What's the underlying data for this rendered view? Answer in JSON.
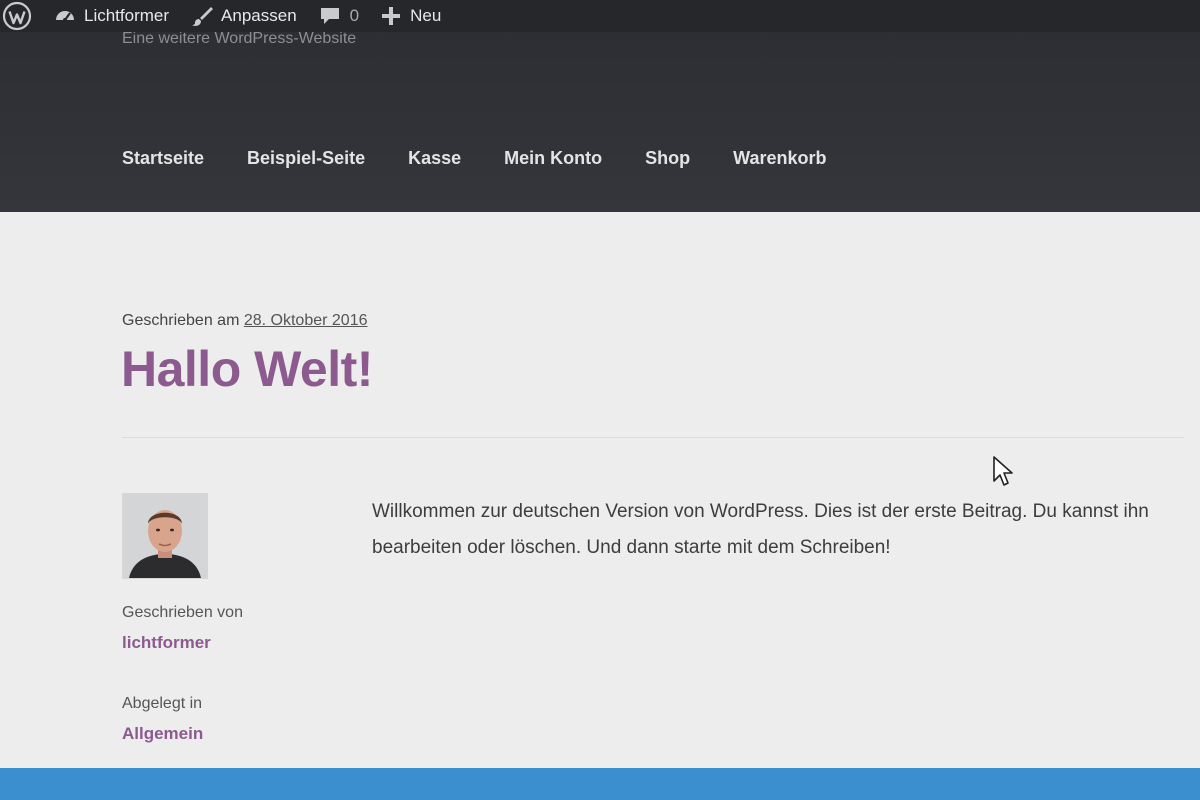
{
  "adminbar": {
    "wp_icon": "wordpress-logo-icon",
    "items": [
      {
        "icon": "dashboard-gauge-icon",
        "label": "Lichtformer"
      },
      {
        "icon": "paintbrush-icon",
        "label": "Anpassen"
      },
      {
        "icon": "comment-bubble-icon",
        "label": "0"
      },
      {
        "icon": "plus-icon",
        "label": "Neu"
      }
    ]
  },
  "header": {
    "tagline": "Eine weitere WordPress-Website",
    "nav": [
      "Startseite",
      "Beispiel-Seite",
      "Kasse",
      "Mein Konto",
      "Shop",
      "Warenkorb"
    ]
  },
  "post": {
    "posted_prefix": "Geschrieben am",
    "date": "28. Oktober 2016",
    "title": "Hallo Welt!",
    "author_label": "Geschrieben von",
    "author": "lichtformer",
    "category_label": "Abgelegt in",
    "category": "Allgemein",
    "content": "Willkommen zur deutschen Version von WordPress. Dies ist der erste Beitrag. Du kannst ihn bearbeiten oder löschen. Und dann starte mit dem Schreiben!"
  },
  "colors": {
    "admin_bar": "#26272b",
    "header": "#313237",
    "accent": "#8c5a8f",
    "footer": "#3b8fcf",
    "background": "#ededed"
  }
}
